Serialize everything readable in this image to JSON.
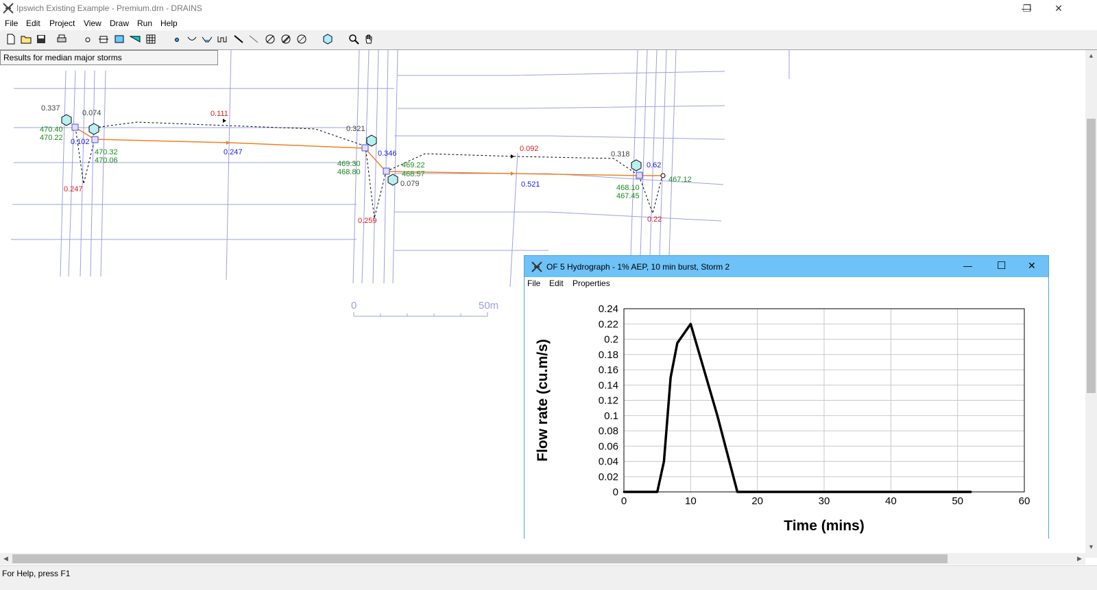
{
  "window": {
    "title": "Ipswich Existing Example - Premium.drn - DRAINS",
    "minimize": "—",
    "restore": "❐",
    "close": "✕"
  },
  "menu": [
    "File",
    "Edit",
    "Project",
    "View",
    "Draw",
    "Run",
    "Help"
  ],
  "toolbar": {
    "icons": [
      "new-file-icon",
      "open-folder-icon",
      "save-icon",
      "print-icon",
      "node-icon",
      "pit-icon",
      "detention-basin-icon",
      "channel-icon",
      "table-icon",
      "junction-icon",
      "overflow-route-icon",
      "swale-icon",
      "weir-icon",
      "pipe-icon",
      "link-icon",
      "sub-catchment-icon",
      "sub-catchment-2-icon",
      "sub-catchment-3-icon",
      "hexagon-icon",
      "zoom-icon",
      "pan-hand-icon"
    ]
  },
  "canvas": {
    "results_label": "Results for median major storms",
    "scale_bar": {
      "start": "0",
      "end": "50m"
    },
    "labels": [
      {
        "text": "0.337",
        "color": "#404040"
      },
      {
        "text": "0.074",
        "color": "#404040"
      },
      {
        "text": "470.40",
        "color": "#1a8a1a"
      },
      {
        "text": "470.22",
        "color": "#1a8a1a"
      },
      {
        "text": "0.102",
        "color": "#1a1ae0"
      },
      {
        "text": "470.32",
        "color": "#1a8a1a"
      },
      {
        "text": "470.06",
        "color": "#1a8a1a"
      },
      {
        "text": "0.247",
        "color": "#e01a1a"
      },
      {
        "text": "0.111",
        "color": "#e01a1a"
      },
      {
        "text": "0.247",
        "color": "#1a1ae0"
      },
      {
        "text": "0.321",
        "color": "#404040"
      },
      {
        "text": "0.346",
        "color": "#1a1ae0"
      },
      {
        "text": "469.30",
        "color": "#1a8a1a"
      },
      {
        "text": "468.80",
        "color": "#1a8a1a"
      },
      {
        "text": "469.22",
        "color": "#1a8a1a"
      },
      {
        "text": "468.57",
        "color": "#1a8a1a"
      },
      {
        "text": "0.079",
        "color": "#404040"
      },
      {
        "text": "0.259",
        "color": "#e01a1a"
      },
      {
        "text": "0.092",
        "color": "#e01a1a"
      },
      {
        "text": "0.521",
        "color": "#1a1ae0"
      },
      {
        "text": "0.318",
        "color": "#404040"
      },
      {
        "text": "0.62",
        "color": "#1a1ae0"
      },
      {
        "text": "468.10",
        "color": "#1a8a1a"
      },
      {
        "text": "467.45",
        "color": "#1a8a1a"
      },
      {
        "text": "467.12",
        "color": "#1a8a1a"
      },
      {
        "text": "0.22",
        "color": "#e01a1a"
      }
    ]
  },
  "status": {
    "text": "For Help, press F1"
  },
  "hydrograph": {
    "title": "OF 5 Hydrograph - 1% AEP, 10 min burst, Storm 2",
    "menu": [
      "File",
      "Edit",
      "Properties"
    ],
    "minimize": "—",
    "maximize": "☐",
    "close": "✕"
  },
  "chart_data": {
    "type": "line",
    "title": "",
    "xlabel": "Time (mins)",
    "ylabel": "Flow rate (cu.m/s)",
    "xlim": [
      0,
      60
    ],
    "ylim": [
      0,
      0.24
    ],
    "xticks": [
      "0",
      "10",
      "20",
      "30",
      "40",
      "50",
      "60"
    ],
    "yticks": [
      "0",
      "0.02",
      "0.04",
      "0.06",
      "0.08",
      "0.1",
      "0.12",
      "0.14",
      "0.16",
      "0.18",
      "0.2",
      "0.22",
      "0.24"
    ],
    "grid": true,
    "series": [
      {
        "name": "",
        "x": [
          0,
          5,
          6,
          7,
          8,
          10,
          12,
          14,
          17,
          52
        ],
        "y": [
          0,
          0,
          0.04,
          0.15,
          0.195,
          0.22,
          0.16,
          0.1,
          0,
          0
        ]
      }
    ]
  }
}
